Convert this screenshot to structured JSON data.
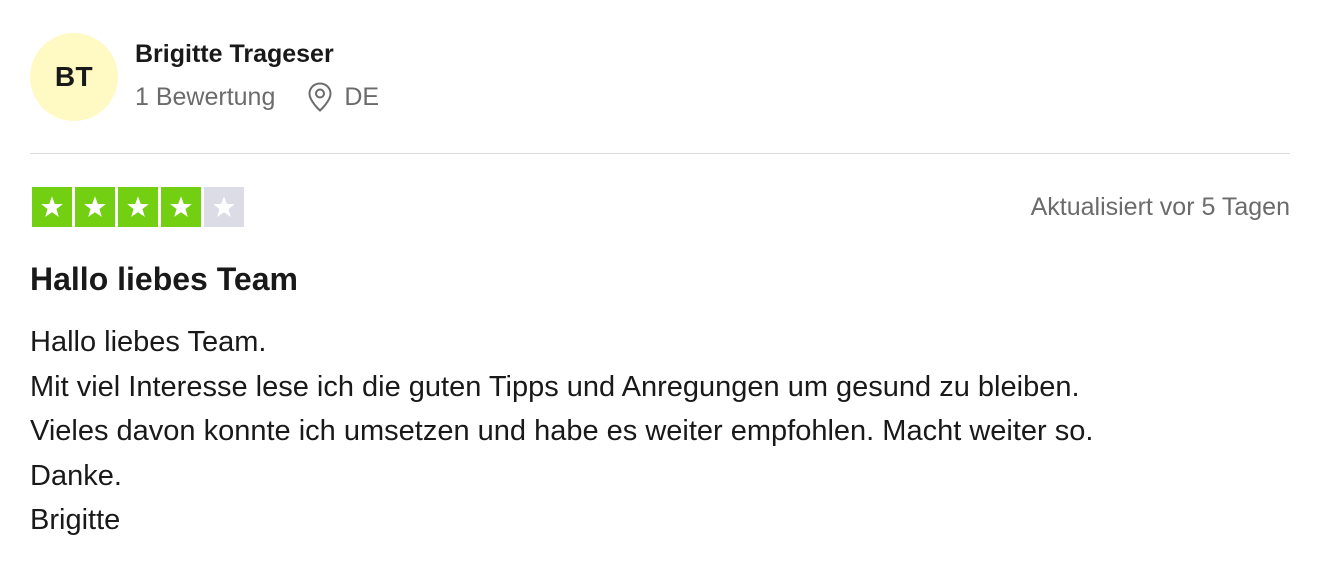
{
  "consumer": {
    "initials": "BT",
    "name": "Brigitte Trageser",
    "review_count": "1 Bewertung",
    "location": "DE",
    "avatar_color": "#fff9c4"
  },
  "rating": {
    "stars": 4,
    "max_stars": 5,
    "filled_color": "#73cf11",
    "empty_color": "#dcdce6",
    "star_icon": "star-icon"
  },
  "date_label": "Aktualisiert vor 5 Tagen",
  "review": {
    "title": "Hallo liebes Team",
    "lines": [
      "Hallo liebes Team.",
      "Mit viel Interesse lese ich die guten Tipps und Anregungen um gesund zu bleiben.",
      "Vieles davon konnte ich umsetzen und habe es weiter empfohlen. Macht weiter so.",
      "Danke.",
      "Brigitte"
    ]
  }
}
